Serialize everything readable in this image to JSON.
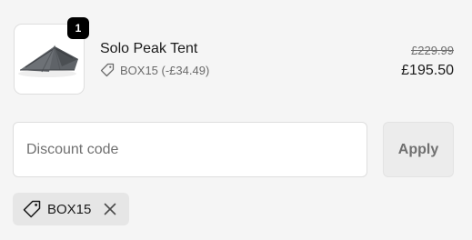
{
  "line_item": {
    "quantity": "1",
    "product_name": "Solo Peak Tent",
    "applied_code_note": "BOX15 (-£34.49)",
    "original_price": "£229.99",
    "final_price": "£195.50",
    "image_icon": "tent-icon"
  },
  "discount_form": {
    "input_placeholder": "Discount code",
    "input_value": "",
    "apply_label": "Apply"
  },
  "applied_discounts": [
    {
      "code": "BOX15",
      "icon": "tag-icon",
      "remove_icon": "close-icon"
    }
  ],
  "colors": {
    "page_background": "#f5f5f5",
    "badge_background": "#000000",
    "chip_background": "#e6e6e6",
    "muted_text": "#6b6b6b",
    "primary_text": "#1a1a1a"
  }
}
